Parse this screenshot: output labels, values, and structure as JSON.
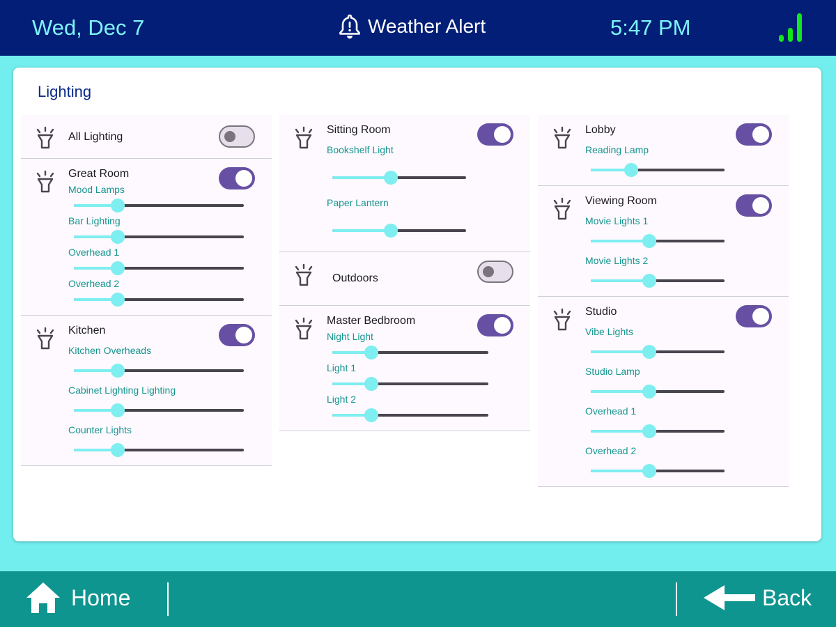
{
  "status": {
    "date": "Wed, Dec 7",
    "alert": "Weather Alert",
    "time": "5:47 PM",
    "signal_color": "#14e61e"
  },
  "card": {
    "title": "Lighting"
  },
  "groups": {
    "all": {
      "name": "All Lighting",
      "on": false
    },
    "great_room": {
      "name": "Great Room",
      "on": true,
      "lights": [
        {
          "label": "Mood Lamps",
          "level": 0.26
        },
        {
          "label": "Bar Lighting",
          "level": 0.26
        },
        {
          "label": "Overhead 1",
          "level": 0.26
        },
        {
          "label": "Overhead 2",
          "level": 0.26
        }
      ]
    },
    "kitchen": {
      "name": "Kitchen",
      "on": true,
      "lights": [
        {
          "label": "Kitchen Overheads",
          "level": 0.26
        },
        {
          "label": "Cabinet Lighting Lighting",
          "level": 0.26
        },
        {
          "label": "Counter Lights",
          "level": 0.26
        }
      ]
    },
    "sitting_room": {
      "name": "Sitting Room",
      "on": true,
      "lights": [
        {
          "label": "Bookshelf Light",
          "level": 0.44
        },
        {
          "label": "Paper Lantern",
          "level": 0.44
        }
      ]
    },
    "outdoors": {
      "name": "Outdoors",
      "on": false
    },
    "master_bedroom": {
      "name": "Master Bedbroom",
      "on": true,
      "lights": [
        {
          "label": "Night Light",
          "level": 0.25
        },
        {
          "label": "Light 1",
          "level": 0.25
        },
        {
          "label": "Light 2",
          "level": 0.25
        }
      ]
    },
    "lobby": {
      "name": "Lobby",
      "on": true,
      "lights": [
        {
          "label": "Reading Lamp",
          "level": 0.3
        }
      ]
    },
    "viewing_room": {
      "name": "Viewing Room",
      "on": true,
      "lights": [
        {
          "label": "Movie Lights 1",
          "level": 0.44
        },
        {
          "label": "Movie Lights 2",
          "level": 0.44
        }
      ]
    },
    "studio": {
      "name": "Studio",
      "on": true,
      "lights": [
        {
          "label": "Vibe Lights",
          "level": 0.44
        },
        {
          "label": "Studio Lamp",
          "level": 0.44
        },
        {
          "label": "Overhead 1",
          "level": 0.44
        },
        {
          "label": "Overhead 2",
          "level": 0.44
        }
      ]
    }
  },
  "nav": {
    "home": "Home",
    "back": "Back"
  },
  "colors": {
    "header_bg": "#021e77",
    "accent_text": "#7df3f8",
    "page_bg": "#72eeee",
    "toggle_on": "#6750a4",
    "slider_active": "#7eeef0",
    "label_teal": "#15958f",
    "bottom_bg": "#0f958f"
  }
}
